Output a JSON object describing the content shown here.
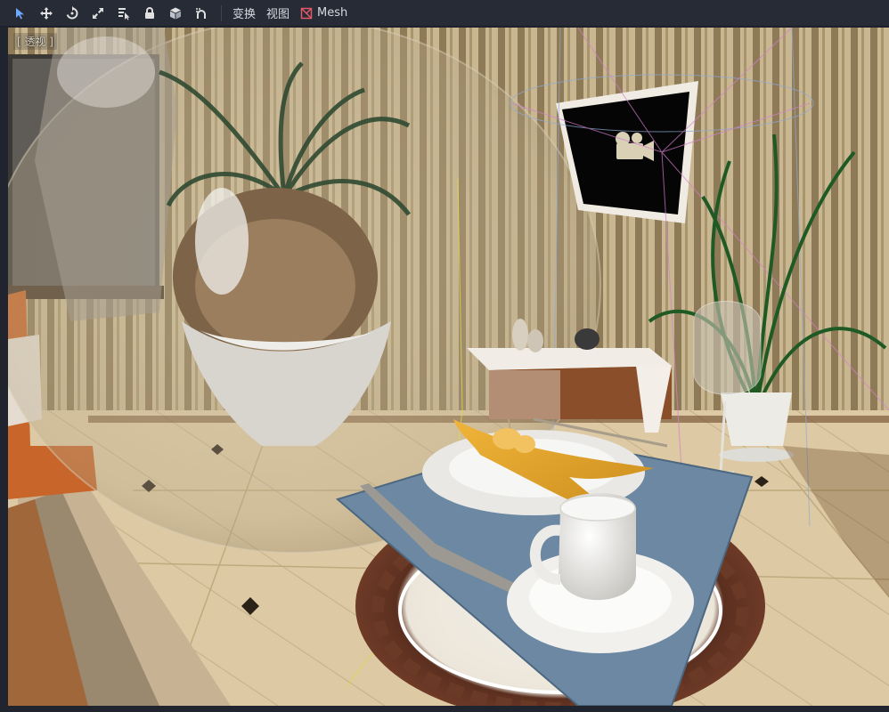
{
  "toolbar": {
    "tools": [
      {
        "name": "select-tool",
        "icon": "cursor-arrow-icon",
        "active": true
      },
      {
        "name": "move-tool",
        "icon": "move-cross-icon"
      },
      {
        "name": "rotate-tool",
        "icon": "rotate-icon"
      },
      {
        "name": "scale-tool",
        "icon": "scale-icon"
      },
      {
        "name": "list-select-tool",
        "icon": "list-select-icon"
      },
      {
        "name": "lock-tool",
        "icon": "lock-icon"
      },
      {
        "name": "group-tool",
        "icon": "cube-icon"
      },
      {
        "name": "snap-tool",
        "icon": "snap-icon"
      }
    ],
    "transform_menu": "变换",
    "view_menu": "视图",
    "mesh_menu": "Mesh",
    "accent_color": "#6fa8ff",
    "mesh_icon_color": "#e05a6a"
  },
  "viewport": {
    "perspective_label": "[ 透视 ]"
  }
}
